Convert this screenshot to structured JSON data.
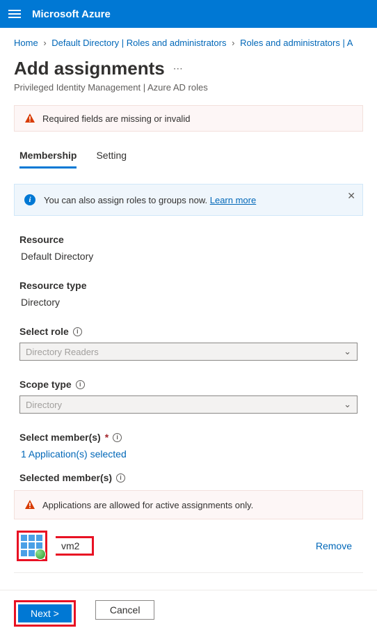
{
  "topbar": {
    "brand": "Microsoft Azure"
  },
  "breadcrumbs": {
    "items": [
      "Home",
      "Default Directory | Roles and administrators",
      "Roles and administrators | A"
    ]
  },
  "page": {
    "title": "Add assignments",
    "subtitle": "Privileged Identity Management | Azure AD roles"
  },
  "alerts": {
    "required_invalid": "Required fields are missing or invalid",
    "groups_info_prefix": "You can also assign roles to groups now. ",
    "groups_info_link": "Learn more",
    "active_only": "Applications are allowed for active assignments only."
  },
  "tabs": {
    "membership": "Membership",
    "setting": "Setting"
  },
  "form": {
    "resource_label": "Resource",
    "resource_value": "Default Directory",
    "resource_type_label": "Resource type",
    "resource_type_value": "Directory",
    "select_role_label": "Select role",
    "select_role_value": "Directory Readers",
    "scope_type_label": "Scope type",
    "scope_type_value": "Directory",
    "select_members_label": "Select member(s)",
    "select_members_link": "1 Application(s) selected",
    "selected_members_label": "Selected member(s)"
  },
  "members": [
    {
      "name": "vm2",
      "remove": "Remove"
    }
  ],
  "footer": {
    "next": "Next >",
    "cancel": "Cancel"
  }
}
